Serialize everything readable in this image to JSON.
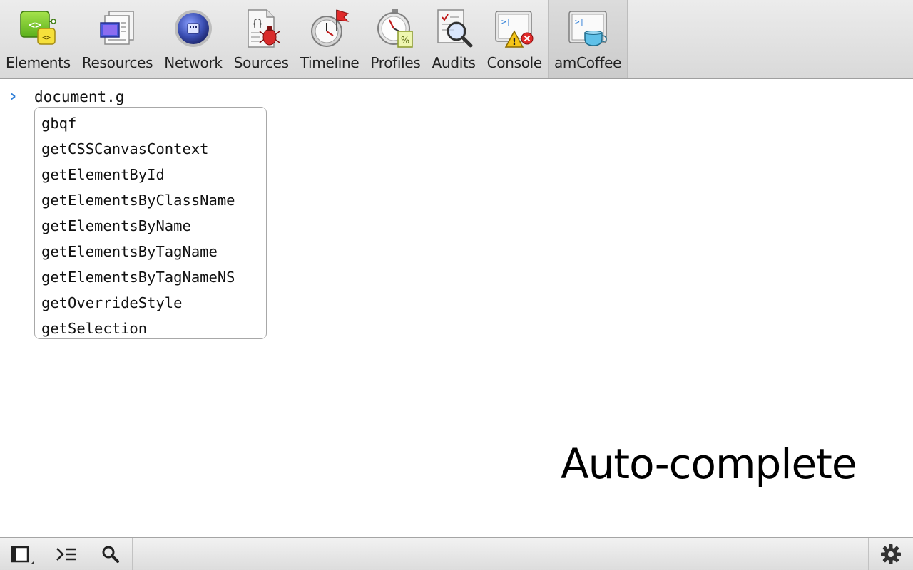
{
  "toolbar": {
    "tabs": [
      {
        "label": "Elements",
        "icon": "elements-icon"
      },
      {
        "label": "Resources",
        "icon": "resources-icon"
      },
      {
        "label": "Network",
        "icon": "network-icon"
      },
      {
        "label": "Sources",
        "icon": "sources-icon"
      },
      {
        "label": "Timeline",
        "icon": "timeline-icon"
      },
      {
        "label": "Profiles",
        "icon": "profiles-icon"
      },
      {
        "label": "Audits",
        "icon": "audits-icon"
      },
      {
        "label": "Console",
        "icon": "console-icon"
      },
      {
        "label": "amCoffee",
        "icon": "amcoffee-icon"
      }
    ],
    "selected": "amCoffee"
  },
  "console": {
    "prompt_symbol": "›",
    "input": "document.g",
    "suggestions": [
      "gbqf",
      "getCSSCanvasContext",
      "getElementById",
      "getElementsByClassName",
      "getElementsByName",
      "getElementsByTagName",
      "getElementsByTagNameNS",
      "getOverrideStyle",
      "getSelection"
    ]
  },
  "caption": "Auto-complete",
  "statusbar": {
    "buttons": [
      "dock-toggle-icon",
      "console-drawer-icon",
      "search-icon"
    ],
    "settings": "gear-icon"
  },
  "colors": {
    "prompt_accent": "#2f7fd8",
    "elements_green": "#7ccf2c",
    "network_blue": "#3b4fb3",
    "timeline_red": "#d92626",
    "console_warning": "#f5c518"
  }
}
